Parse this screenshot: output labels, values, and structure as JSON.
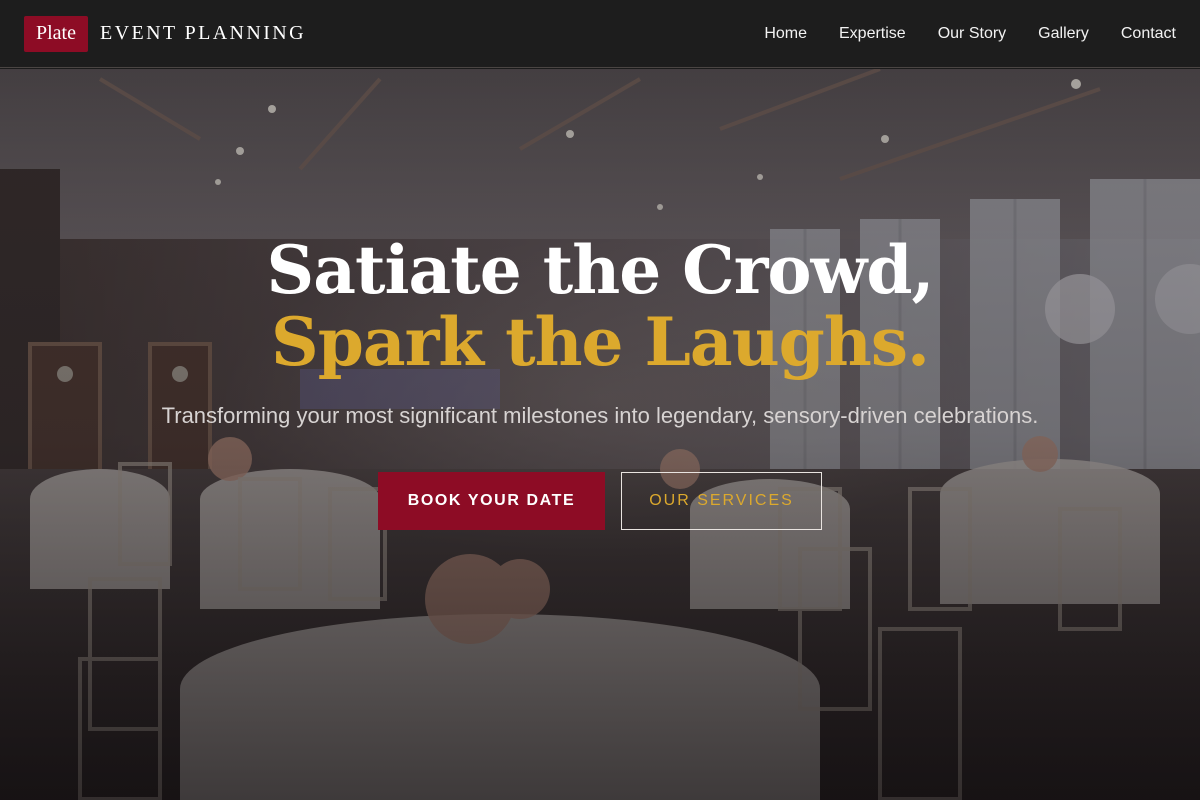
{
  "brand": {
    "badge": "Plate",
    "name": "EVENT PLANNING"
  },
  "nav": {
    "items": [
      "Home",
      "Expertise",
      "Our Story",
      "Gallery",
      "Contact"
    ]
  },
  "hero": {
    "headline_line1": "Satiate the Crowd,",
    "headline_line2": "Spark the Laughs.",
    "subtitle": "Transforming your most significant milestones into legendary, sensory-driven celebrations.",
    "primary_cta": "BOOK YOUR DATE",
    "secondary_cta": "OUR SERVICES"
  },
  "colors": {
    "brand": "#8d0c25",
    "accent": "#dca92d",
    "header_bg": "#1d1d1d"
  }
}
